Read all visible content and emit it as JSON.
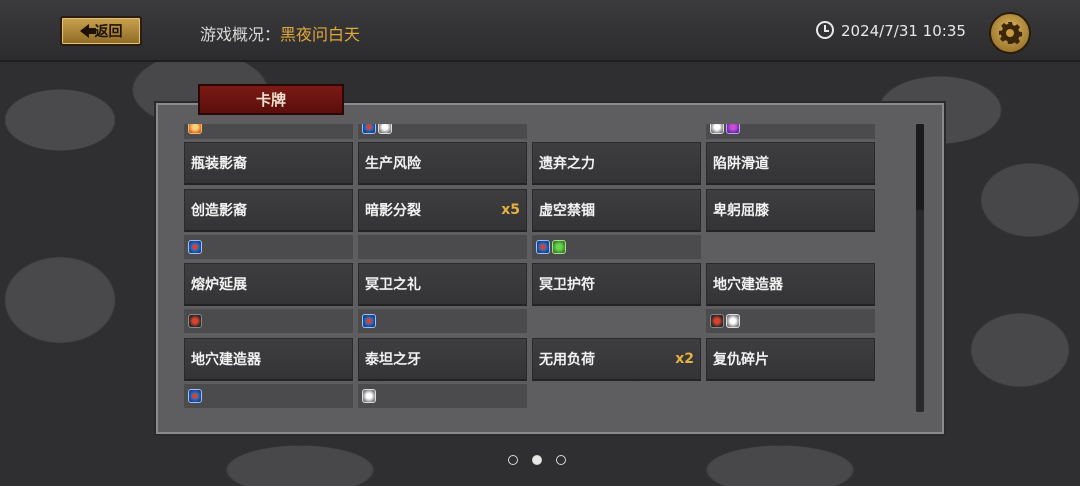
{
  "header": {
    "back_label": "返回",
    "title_label": "游戏概况：",
    "title_value": "黑夜问白天",
    "datetime": "2024/7/31 10:35"
  },
  "tab": {
    "label": "卡牌"
  },
  "cards": [
    {
      "name": "瓶装影裔",
      "count": ""
    },
    {
      "name": "生产风险",
      "count": ""
    },
    {
      "name": "遗弃之力",
      "count": ""
    },
    {
      "name": "陷阱滑道",
      "count": ""
    },
    {
      "name": "创造影裔",
      "count": ""
    },
    {
      "name": "暗影分裂",
      "count": "x5"
    },
    {
      "name": "虚空禁锢",
      "count": ""
    },
    {
      "name": "卑躬屈膝",
      "count": ""
    },
    {
      "name": "熔炉延展",
      "count": ""
    },
    {
      "name": "冥卫之礼",
      "count": ""
    },
    {
      "name": "冥卫护符",
      "count": ""
    },
    {
      "name": "地穴建造器",
      "count": ""
    },
    {
      "name": "地穴建造器",
      "count": ""
    },
    {
      "name": "泰坦之牙",
      "count": ""
    },
    {
      "name": "无用负荷",
      "count": "x2"
    },
    {
      "name": "复仇碎片",
      "count": ""
    }
  ],
  "icons": {
    "top": [
      [
        "orange"
      ],
      [
        "blue",
        "white"
      ],
      [],
      [
        "white",
        "purple"
      ]
    ],
    "row2": [
      [
        "blue"
      ],
      [],
      [
        "blue",
        "green"
      ],
      []
    ],
    "row3": [
      [
        "dark"
      ],
      [
        "blue"
      ],
      [],
      [
        "dark",
        "white"
      ]
    ],
    "row4": [
      [
        "blue"
      ],
      [
        "white"
      ],
      [],
      []
    ]
  },
  "pagination": {
    "pages": 3,
    "active": 2
  }
}
